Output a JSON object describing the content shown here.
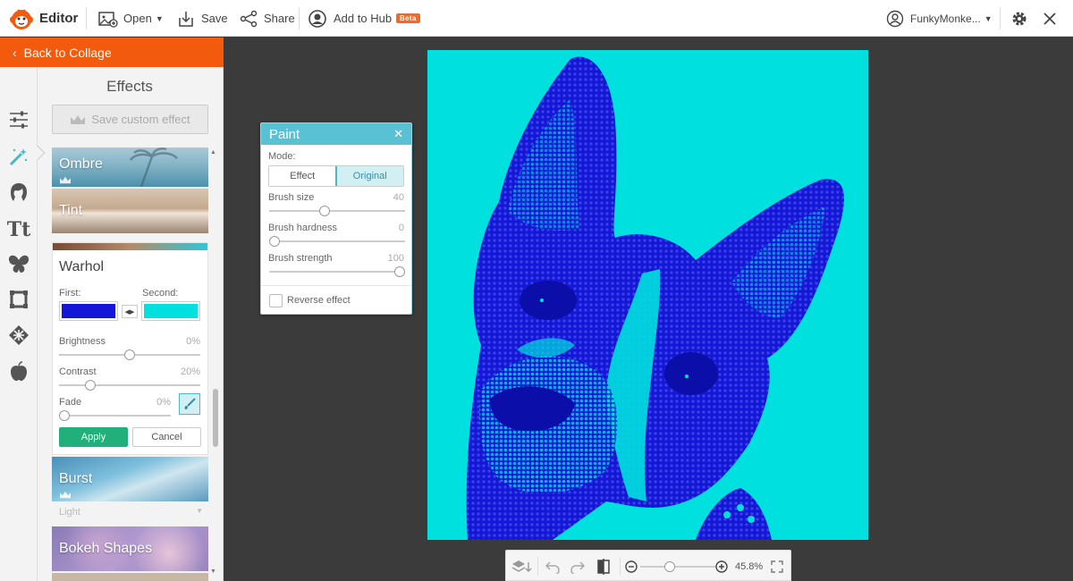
{
  "app": {
    "name": "Editor"
  },
  "topbar": {
    "open_label": "Open",
    "save_label": "Save",
    "share_label": "Share",
    "hub_label": "Add to Hub",
    "beta_badge": "Beta",
    "user_name": "FunkyMonke..."
  },
  "sidebar": {
    "back_label": "Back to Collage",
    "title": "Effects",
    "save_custom_label": "Save custom effect",
    "rail_icons": [
      "sliders-icon",
      "magic-wand-icon",
      "face-icon",
      "text-icon",
      "butterfly-icon",
      "frame-icon",
      "texture-icon",
      "apple-icon"
    ],
    "effects": {
      "ombre": "Ombre",
      "tint": "Tint",
      "burst": "Burst",
      "light_label": "Light",
      "bokeh": "Bokeh Shapes"
    },
    "warhol": {
      "title": "Warhol",
      "first_label": "First:",
      "second_label": "Second:",
      "first_color": "#1417d6",
      "second_color": "#00e1df",
      "brightness_label": "Brightness",
      "brightness_value": "0%",
      "brightness_level": 0.5,
      "contrast_label": "Contrast",
      "contrast_value": "20%",
      "contrast_level": 0.2,
      "fade_label": "Fade",
      "fade_value": "0%",
      "fade_level": 0,
      "apply_label": "Apply",
      "cancel_label": "Cancel"
    }
  },
  "paint_dialog": {
    "title": "Paint",
    "mode_label": "Mode:",
    "mode_effect": "Effect",
    "mode_original": "Original",
    "brush_size_label": "Brush size",
    "brush_size_value": "40",
    "brush_hardness_label": "Brush hardness",
    "brush_hardness_value": "0",
    "brush_strength_label": "Brush strength",
    "brush_strength_value": "100",
    "reverse_label": "Reverse effect"
  },
  "bottombar": {
    "zoom_value": "45.8%"
  },
  "colors": {
    "accent": "#f25a0d",
    "teal": "#58c2d4",
    "apply": "#21b07c",
    "photo_bg": "#00e1df",
    "photo_fg": "#1417d6"
  }
}
